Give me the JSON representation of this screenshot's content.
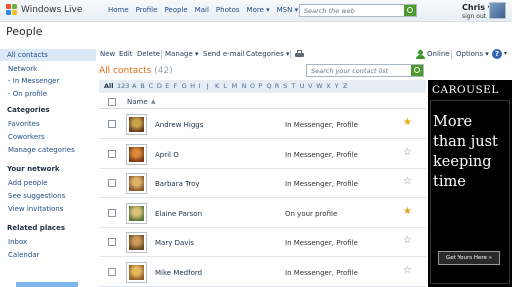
{
  "header": {
    "brand": "Windows Live",
    "nav": [
      "Home",
      "Profile",
      "People",
      "Mail",
      "Photos",
      "More ▾",
      "MSN ▾"
    ],
    "search_placeholder": "Search the web",
    "user_name": "Chris ▾",
    "sign_out": "sign out"
  },
  "page_title": "People",
  "sidebar": {
    "items": [
      "All contacts",
      "Network",
      "- In Messenger",
      "- On profile"
    ],
    "categories_heading": "Categories",
    "categories": [
      "Favorites",
      "Coworkers",
      "Manage categories"
    ],
    "network_heading": "Your network",
    "network": [
      "Add people",
      "See suggestions",
      "View invitations"
    ],
    "related_heading": "Related places",
    "related": [
      "Inbox",
      "Calendar"
    ]
  },
  "toolbar": {
    "new": "New",
    "edit": "Edit",
    "delete": "Delete",
    "manage": "Manage ▾",
    "send_email": "Send e-mail",
    "categories": "Categories ▾",
    "online": "Online",
    "options": "Options ▾",
    "help": "?"
  },
  "list": {
    "title": "All contacts",
    "count": "(42)",
    "search_placeholder": "Search your contact list",
    "alpha": [
      "All",
      "123",
      "A",
      "B",
      "C",
      "D",
      "E",
      "F",
      "G",
      "H",
      "I",
      "J",
      "K",
      "L",
      "M",
      "N",
      "O",
      "P",
      "Q",
      "R",
      "S",
      "T",
      "U",
      "V",
      "W",
      "X",
      "Y",
      "Z"
    ],
    "name_header": "Name",
    "sort_arrow": "▲"
  },
  "contacts": [
    {
      "name": "Andrew Higgs",
      "status": "In Messenger, Profile",
      "favorite": true,
      "pic": [
        "#c9a24a",
        "#6b3f1d"
      ]
    },
    {
      "name": "April O",
      "status": "In Messenger, Profile",
      "favorite": false,
      "pic": [
        "#d98a3a",
        "#7a3b14"
      ]
    },
    {
      "name": "Barbara Troy",
      "status": "In Messenger, Profile",
      "favorite": false,
      "pic": [
        "#e0b36a",
        "#8a5a2b"
      ]
    },
    {
      "name": "Elaine Parson",
      "status": "On your profile",
      "favorite": true,
      "pic": [
        "#d9c27a",
        "#5e7a3a"
      ]
    },
    {
      "name": "Mary Davis",
      "status": "In Messenger, Profile",
      "favorite": false,
      "pic": [
        "#c99a5a",
        "#6e4a22"
      ]
    },
    {
      "name": "Mike Medford",
      "status": "In Messenger, Profile",
      "favorite": false,
      "pic": [
        "#e6b95e",
        "#93602a"
      ]
    }
  ],
  "ad": {
    "brand": "CAROUSEL",
    "lines": [
      "More",
      "than just",
      "keeping",
      "time"
    ],
    "cta": "Get Yours Here »"
  },
  "colors": {
    "link": "#1e4e88",
    "accent_orange": "#e26a16",
    "star_favorite": "#e8a316",
    "star_empty": "#7d8894",
    "selected_bg": "#dbe8f6"
  }
}
